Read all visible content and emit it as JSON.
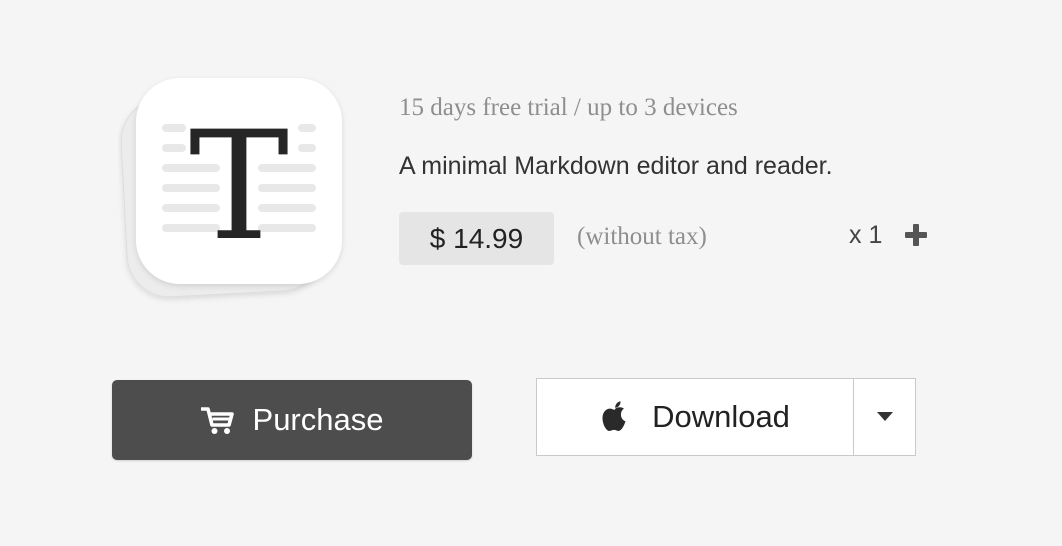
{
  "product": {
    "icon": "typora-t-app-icon",
    "icon_letter": "T",
    "trial_text": "15 days free trial / up to 3 devices",
    "tagline": "A minimal Markdown editor and reader.",
    "price": "$ 14.99",
    "tax_note": "(without tax)",
    "quantity_label": "x 1",
    "quantity_plus_icon": "plus-icon"
  },
  "actions": {
    "purchase_label": "Purchase",
    "purchase_icon": "cart-icon",
    "download_label": "Download",
    "download_icon": "apple-icon",
    "download_menu_icon": "caret-down-icon"
  },
  "colors": {
    "background": "#f5f5f5",
    "purchase_button": "#4d4d4d",
    "price_badge": "#e5e5e5",
    "muted_text": "#8e8e8e"
  }
}
